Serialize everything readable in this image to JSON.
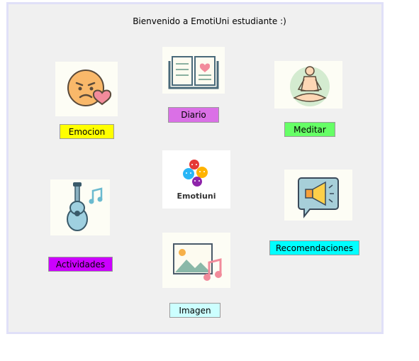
{
  "window": {
    "title": "Bienvenido a EmotiUni estudiante :)"
  },
  "logo": {
    "text": "Emotiuni"
  },
  "buttons": {
    "emocion": {
      "label": "Emocion",
      "color": "#ffff00"
    },
    "diario": {
      "label": "Diario",
      "color": "#da70e6"
    },
    "meditar": {
      "label": "Meditar",
      "color": "#66ff66"
    },
    "actividades": {
      "label": "Actividades",
      "color": "#cc00ff"
    },
    "recomendaciones": {
      "label": "Recomendaciones",
      "color": "#00ffff"
    },
    "imagen": {
      "label": "Imagen",
      "color": "#ccffff"
    }
  },
  "icons": {
    "emocion": "sad-face-heart-icon",
    "diario": "open-book-heart-icon",
    "meditar": "meditation-person-icon",
    "actividades": "guitar-music-note-icon",
    "recomendaciones": "megaphone-icon",
    "imagen": "image-music-note-icon",
    "logo": "emotiuni-logo"
  }
}
